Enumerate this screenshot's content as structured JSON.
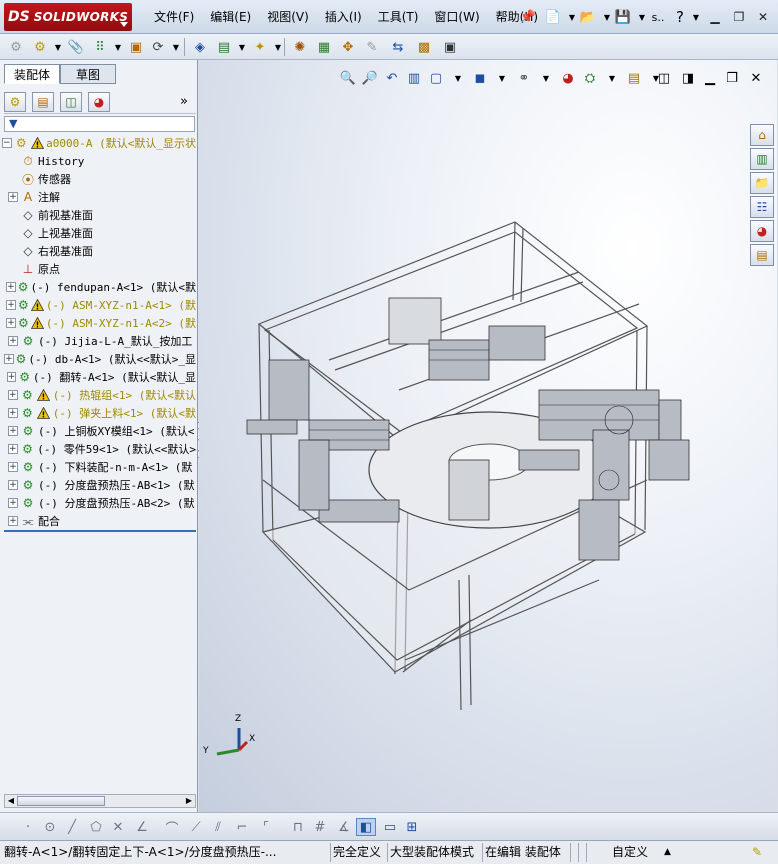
{
  "app": {
    "logo_ds": "DS",
    "logo_text": "SOLIDWORKS"
  },
  "menu": [
    "文件(F)",
    "编辑(E)",
    "视图(V)",
    "插入(I)",
    "工具(T)",
    "窗口(W)",
    "帮助(H)"
  ],
  "titlebar_extra": "s..",
  "tabs": [
    "装配体",
    "草图"
  ],
  "tree": [
    {
      "label": "a0000-A  (默认<默认_显示状",
      "icon": "assembly-icon",
      "warn": true,
      "yellow": true,
      "expander": "minus",
      "indent": 0
    },
    {
      "label": "History",
      "icon": "history-icon",
      "warn": false,
      "yellow": false,
      "expander": "none",
      "indent": 1
    },
    {
      "label": "传感器",
      "icon": "sensor-icon",
      "warn": false,
      "yellow": false,
      "expander": "none",
      "indent": 1
    },
    {
      "label": "注解",
      "icon": "annotation-icon",
      "warn": false,
      "yellow": false,
      "expander": "plus",
      "indent": 1
    },
    {
      "label": "前视基准面",
      "icon": "plane-icon",
      "warn": false,
      "yellow": false,
      "expander": "none",
      "indent": 1
    },
    {
      "label": "上视基准面",
      "icon": "plane-icon",
      "warn": false,
      "yellow": false,
      "expander": "none",
      "indent": 1
    },
    {
      "label": "右视基准面",
      "icon": "plane-icon",
      "warn": false,
      "yellow": false,
      "expander": "none",
      "indent": 1
    },
    {
      "label": "原点",
      "icon": "origin-icon",
      "warn": false,
      "yellow": false,
      "expander": "none",
      "indent": 1
    },
    {
      "label": "(-) fendupan-A<1> (默认<默",
      "icon": "subassembly-icon",
      "warn": false,
      "yellow": false,
      "expander": "plus",
      "indent": 1
    },
    {
      "label": "(-) ASM-XYZ-n1-A<1> (默",
      "icon": "subassembly-icon",
      "warn": true,
      "yellow": true,
      "expander": "plus",
      "indent": 1
    },
    {
      "label": "(-) ASM-XYZ-n1-A<2> (默",
      "icon": "subassembly-icon",
      "warn": true,
      "yellow": true,
      "expander": "plus",
      "indent": 1
    },
    {
      "label": "(-) Jijia-L-A_默认_按加工",
      "icon": "subassembly-icon",
      "warn": false,
      "yellow": false,
      "expander": "plus",
      "indent": 1
    },
    {
      "label": "(-) db-A<1> (默认<<默认>_显",
      "icon": "subassembly-icon",
      "warn": false,
      "yellow": false,
      "expander": "plus",
      "indent": 1
    },
    {
      "label": "(-) 翻转-A<1> (默认<默认_显",
      "icon": "subassembly-icon",
      "warn": false,
      "yellow": false,
      "expander": "plus",
      "indent": 1
    },
    {
      "label": "(-) 热辊组<1> (默认<默认",
      "icon": "subassembly-icon",
      "warn": true,
      "yellow": true,
      "expander": "plus",
      "indent": 1
    },
    {
      "label": "(-) 弹夹上料<1> (默认<默",
      "icon": "subassembly-icon",
      "warn": true,
      "yellow": true,
      "expander": "plus",
      "indent": 1
    },
    {
      "label": "(-) 上铜板XY模组<1> (默认<",
      "icon": "subassembly-icon",
      "warn": false,
      "yellow": false,
      "expander": "plus",
      "indent": 1
    },
    {
      "label": "(-) 零件59<1> (默认<<默认>",
      "icon": "subassembly-icon",
      "warn": false,
      "yellow": false,
      "expander": "plus",
      "indent": 1
    },
    {
      "label": "(-) 下料装配-n-m-A<1> (默",
      "icon": "subassembly-icon",
      "warn": false,
      "yellow": false,
      "expander": "plus",
      "indent": 1
    },
    {
      "label": "(-) 分度盘预热压-AB<1> (默",
      "icon": "subassembly-icon",
      "warn": false,
      "yellow": false,
      "expander": "plus",
      "indent": 1
    },
    {
      "label": "(-) 分度盘预热压-AB<2> (默",
      "icon": "subassembly-icon",
      "warn": false,
      "yellow": false,
      "expander": "plus",
      "indent": 1
    },
    {
      "label": "配合",
      "icon": "mates-icon",
      "warn": false,
      "yellow": false,
      "expander": "plus",
      "indent": 1
    }
  ],
  "triad": {
    "x": "X",
    "y": "Y",
    "z": "Z"
  },
  "status": {
    "path": "翻转-A<1>/翻转固定上下-A<1>/分度盘预热压-...",
    "definition": "完全定义",
    "mode": "大型装配体模式",
    "editing": "在编辑 装配体",
    "units": "自定义"
  },
  "colors": {
    "accent": "#c4161c",
    "selection": "#3a6db5",
    "warn": "#f2c200"
  }
}
